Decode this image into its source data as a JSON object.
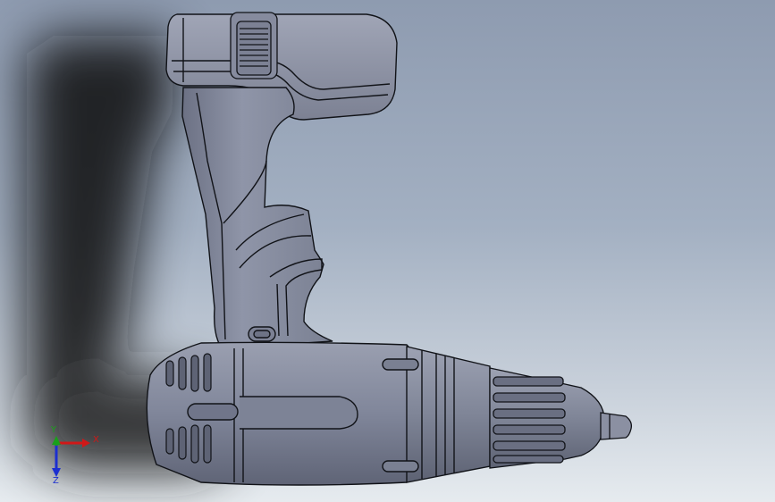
{
  "viewport": {
    "background_top": "#8e9bb0",
    "background_bottom": "#e6ebef"
  },
  "model": {
    "shade_color": "#7e8396",
    "edge_color": "#111318"
  },
  "triad": {
    "x_label": "X",
    "y_label": "Y",
    "z_label": "Z",
    "x_color": "#d01818",
    "y_color": "#1aa01a",
    "z_color": "#1c2fd0"
  }
}
